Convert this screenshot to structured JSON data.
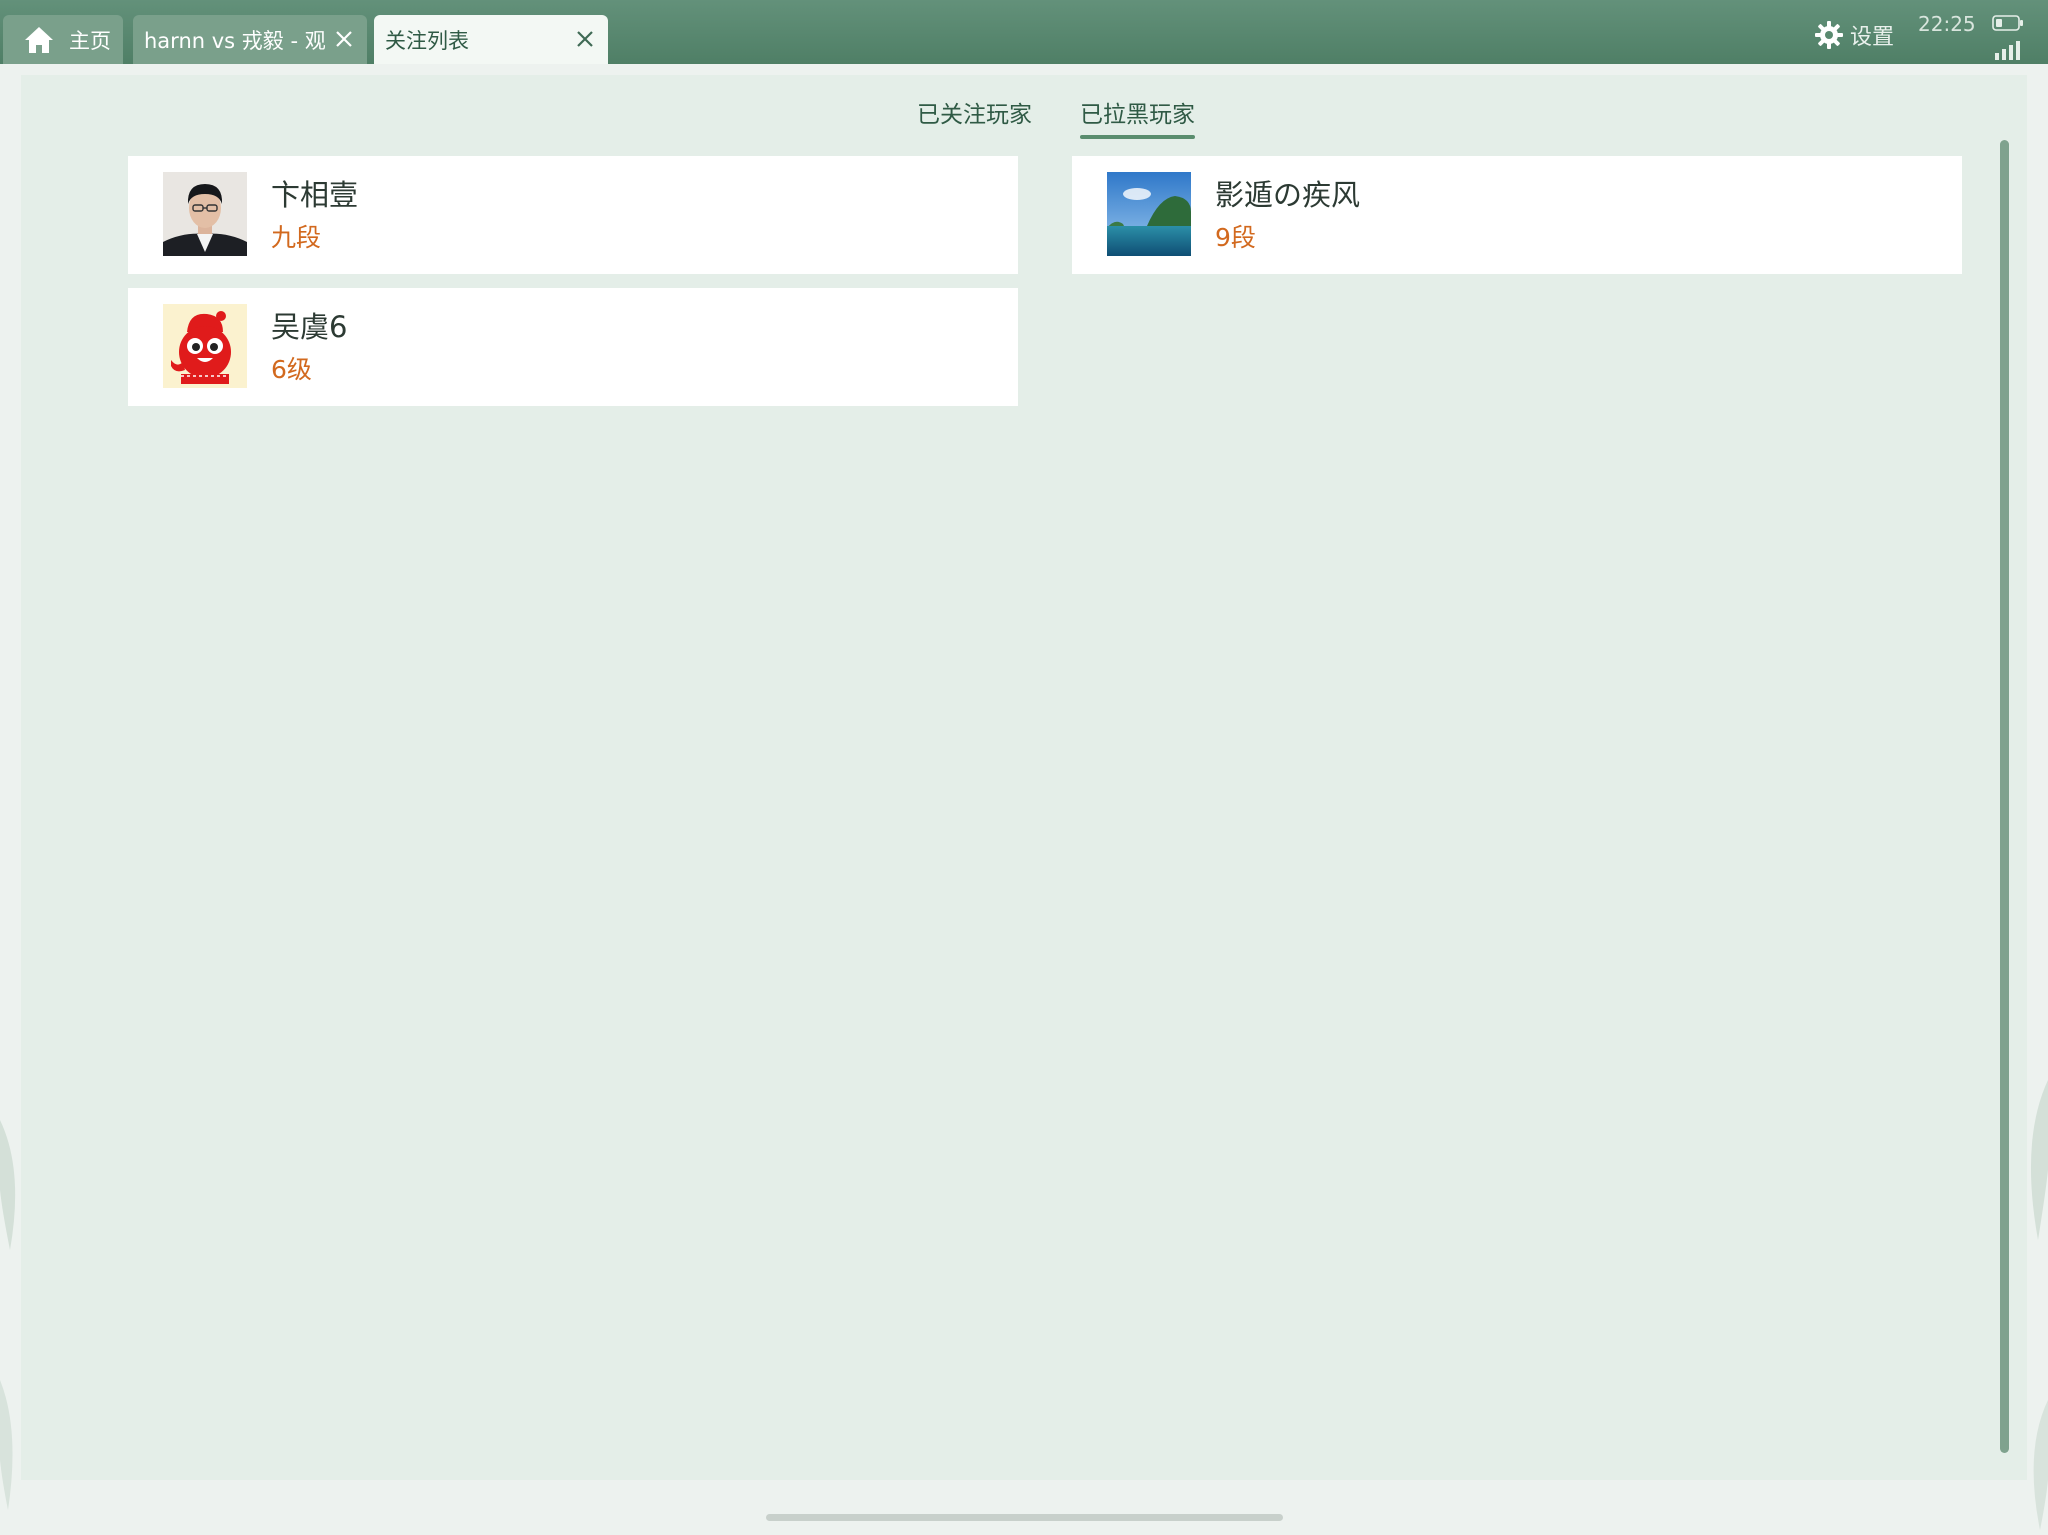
{
  "tabs": {
    "home_label": "主页",
    "game_label": "harnn vs 戎毅 - 观",
    "follow_label": "关注列表"
  },
  "statusbar": {
    "settings_label": "设置",
    "time": "22:25"
  },
  "subtabs": {
    "followed_label": "已关注玩家",
    "blocked_label": "已拉黑玩家",
    "active": "blocked"
  },
  "players": [
    {
      "name": "卞相壹",
      "rank": "九段",
      "avatar": "portrait-photo"
    },
    {
      "name": "影遁の疾风",
      "rank": "9段",
      "avatar": "landscape-photo"
    },
    {
      "name": "吴虞6",
      "rank": "6级",
      "avatar": "red-penguin-mascot"
    }
  ],
  "colors": {
    "header_green": "#5a8a70",
    "accent_green": "#5a8d6e",
    "rank_orange": "#d2691e",
    "panel_bg": "#e4eee8"
  },
  "icons": [
    "home-icon",
    "close-icon",
    "gear-icon",
    "battery-icon",
    "signal-icon"
  ]
}
